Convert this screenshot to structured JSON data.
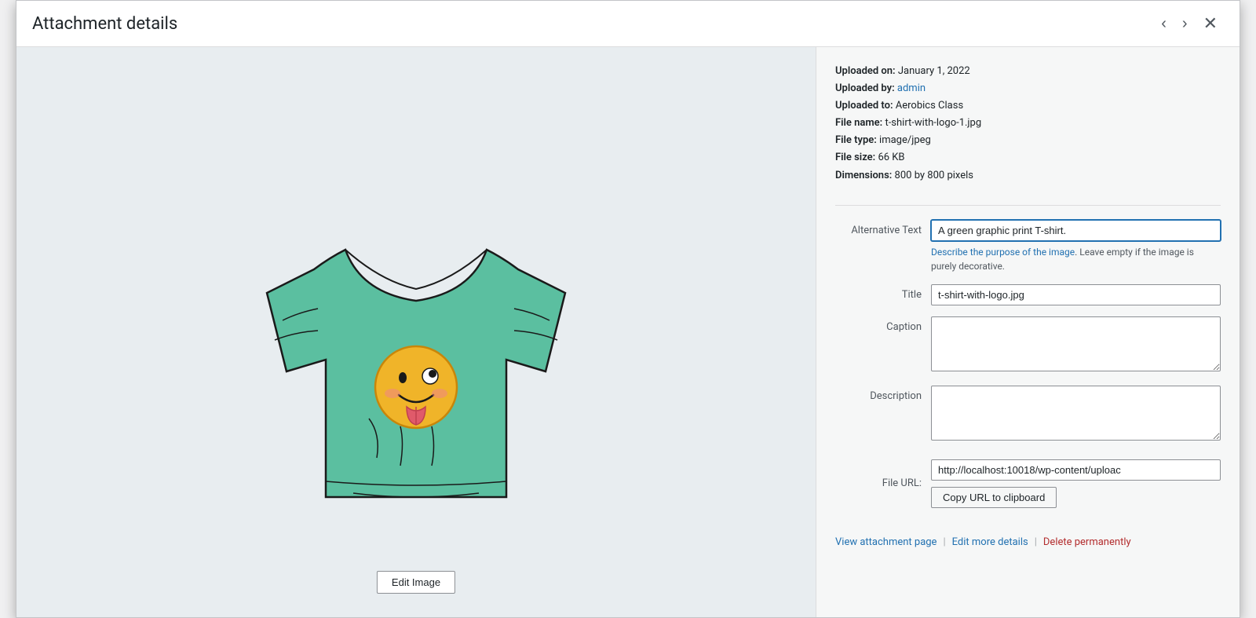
{
  "modal": {
    "title": "Attachment details",
    "nav": {
      "prev_label": "‹",
      "next_label": "›",
      "close_label": "✕"
    }
  },
  "file_info": {
    "uploaded_on_label": "Uploaded on:",
    "uploaded_on_value": "January 1, 2022",
    "uploaded_by_label": "Uploaded by:",
    "uploaded_by_value": "admin",
    "uploaded_to_label": "Uploaded to:",
    "uploaded_to_value": "Aerobics Class",
    "file_name_label": "File name:",
    "file_name_value": "t-shirt-with-logo-1.jpg",
    "file_type_label": "File type:",
    "file_type_value": "image/jpeg",
    "file_size_label": "File size:",
    "file_size_value": "66 KB",
    "dimensions_label": "Dimensions:",
    "dimensions_value": "800 by 800 pixels"
  },
  "fields": {
    "alt_text_label": "Alternative Text",
    "alt_text_value": "A green graphic print T-shirt.",
    "alt_text_help_link": "Describe the purpose of the image",
    "alt_text_help_text": ". Leave empty if the image is purely decorative.",
    "title_label": "Title",
    "title_value": "t-shirt-with-logo.jpg",
    "caption_label": "Caption",
    "caption_value": "",
    "description_label": "Description",
    "description_value": "",
    "file_url_label": "File URL:",
    "file_url_value": "http://localhost:10018/wp-content/uploac",
    "copy_url_btn": "Copy URL to clipboard"
  },
  "footer": {
    "view_attachment_label": "View attachment page",
    "edit_more_label": "Edit more details",
    "delete_label": "Delete permanently",
    "sep": "|"
  },
  "edit_image_btn": "Edit Image"
}
